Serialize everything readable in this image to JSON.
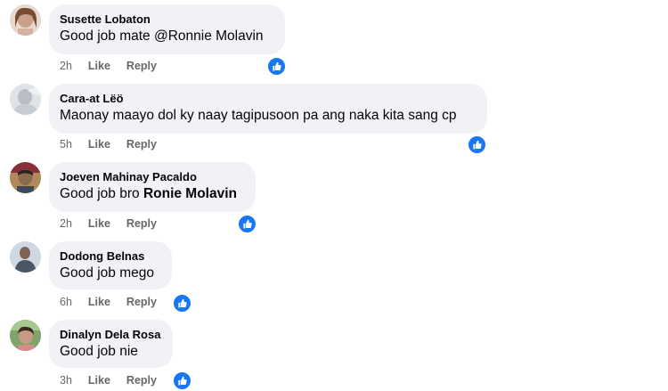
{
  "comments": [
    {
      "author": "Susette Lobaton",
      "text_prefix": "Good job mate ",
      "text_mention": "@Ronnie Molavin",
      "time": "2h",
      "like_label": "Like",
      "reply_label": "Reply"
    },
    {
      "author": "Cara-at Lëö",
      "text_prefix": "Maonay maayo dol ky naay tagipusoon pa ang naka kita sang cp",
      "text_mention": "",
      "time": "5h",
      "like_label": "Like",
      "reply_label": "Reply"
    },
    {
      "author": "Joeven Mahinay Pacaldo",
      "text_prefix": "Good job bro ",
      "text_mention": "Ronie Molavin",
      "time": "2h",
      "like_label": "Like",
      "reply_label": "Reply"
    },
    {
      "author": "Dodong Belnas",
      "text_prefix": "Good job mego",
      "text_mention": "",
      "time": "6h",
      "like_label": "Like",
      "reply_label": "Reply"
    },
    {
      "author": "Dinalyn Dela Rosa",
      "text_prefix": "Good job nie",
      "text_mention": "",
      "time": "3h",
      "like_label": "Like",
      "reply_label": "Reply"
    }
  ],
  "colors": {
    "bubble": "#f0f2f5",
    "text": "#050505",
    "meta": "#65676b",
    "like_badge": "#1877f2"
  },
  "icons": {
    "reaction": "thumbs-up-icon"
  }
}
